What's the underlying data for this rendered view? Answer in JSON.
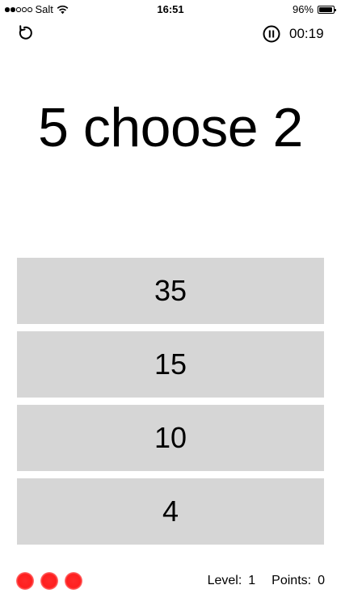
{
  "status_bar": {
    "carrier": "Salt",
    "signal_bars_filled": 2,
    "signal_bars_total": 5,
    "time": "16:51",
    "battery_percent_label": "96%",
    "battery_level": 0.96
  },
  "toolbar": {
    "restart_icon": "restart-icon",
    "pause_icon": "pause-icon",
    "timer": "00:19"
  },
  "question": {
    "text": "5 choose 2"
  },
  "answers": [
    {
      "label": "35"
    },
    {
      "label": "15"
    },
    {
      "label": "10"
    },
    {
      "label": "4"
    }
  ],
  "footer": {
    "lives_remaining": 3,
    "life_color": "#ff2020",
    "level_label": "Level:",
    "level_value": "1",
    "points_label": "Points:",
    "points_value": "0"
  },
  "colors": {
    "answer_background": "#d6d6d6",
    "text": "#000000",
    "background": "#ffffff"
  }
}
